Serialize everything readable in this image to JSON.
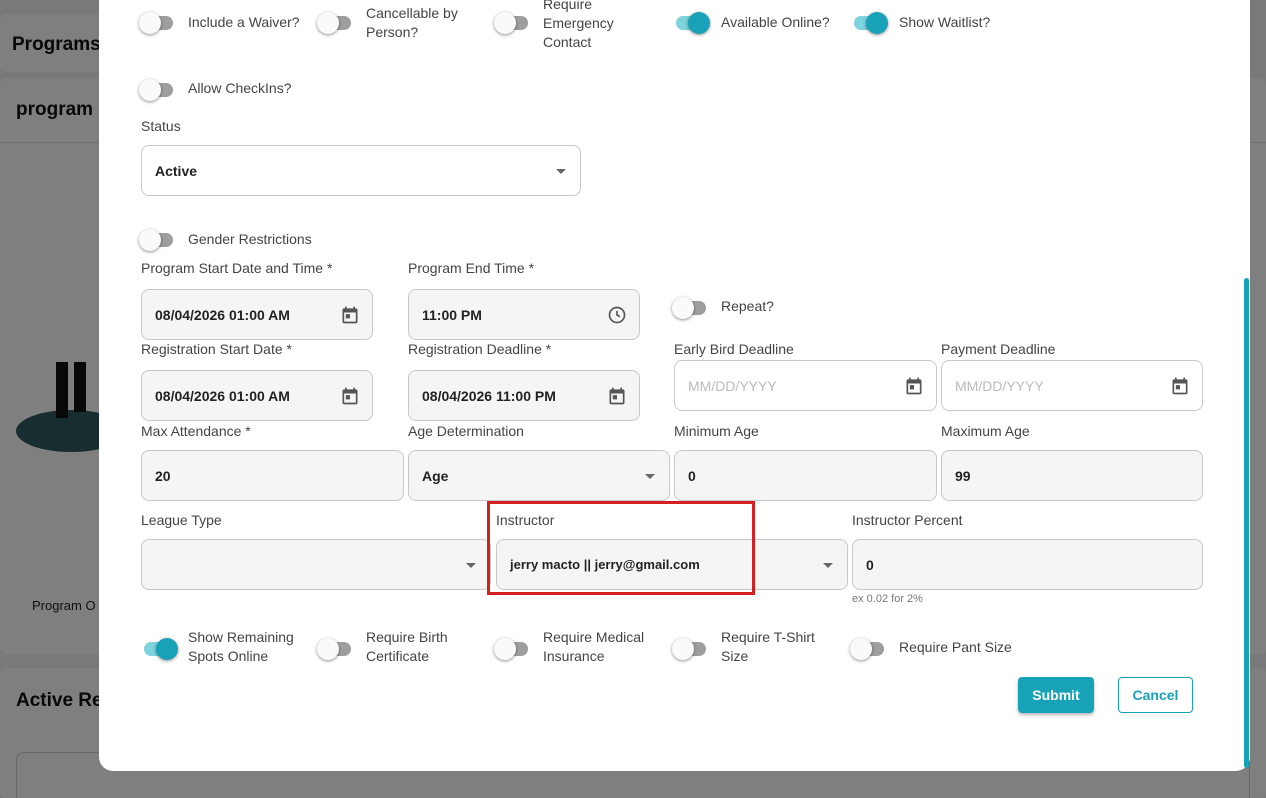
{
  "background": {
    "programs_heading": "Programs",
    "program_title": "program",
    "program_o_text": "Program O",
    "active_heading": "Active Re"
  },
  "toggles_top": [
    {
      "label": "Include a Waiver?",
      "on": false
    },
    {
      "label": "Cancellable by Person?",
      "on": false
    },
    {
      "label": "Require Emergency Contact",
      "on": false
    },
    {
      "label": "Available Online?",
      "on": true
    },
    {
      "label": "Show Waitlist?",
      "on": true
    }
  ],
  "allow_checkins": {
    "label": "Allow CheckIns?",
    "on": false
  },
  "status": {
    "label": "Status",
    "value": "Active"
  },
  "gender_restrictions": {
    "label": "Gender Restrictions",
    "on": false
  },
  "program_start": {
    "label": "Program Start Date and Time *",
    "value": "08/04/2026 01:00 AM",
    "icon": "calendar-icon"
  },
  "program_end": {
    "label": "Program End Time *",
    "value": "11:00 PM",
    "icon": "clock-icon"
  },
  "repeat": {
    "label": "Repeat?",
    "on": false
  },
  "registration_start": {
    "label": "Registration Start Date *",
    "value": "08/04/2026 01:00 AM"
  },
  "registration_deadline": {
    "label": "Registration Deadline *",
    "value": "08/04/2026 11:00 PM"
  },
  "early_bird": {
    "label": "Early Bird Deadline",
    "placeholder": "MM/DD/YYYY"
  },
  "payment_deadline": {
    "label": "Payment Deadline",
    "placeholder": "MM/DD/YYYY"
  },
  "max_attendance": {
    "label": "Max Attendance *",
    "value": "20"
  },
  "age_determination": {
    "label": "Age Determination",
    "value": "Age"
  },
  "minimum_age": {
    "label": "Minimum Age",
    "value": "0"
  },
  "maximum_age": {
    "label": "Maximum Age",
    "value": "99"
  },
  "league_type": {
    "label": "League Type",
    "value": ""
  },
  "instructor": {
    "label": "Instructor",
    "value": "jerry macto || jerry@gmail.com"
  },
  "instructor_percent": {
    "label": "Instructor Percent",
    "value": "0",
    "hint": "ex 0.02 for 2%"
  },
  "toggles_bottom": [
    {
      "label": "Show Remaining Spots Online",
      "on": true
    },
    {
      "label": "Require Birth Certificate",
      "on": false
    },
    {
      "label": "Require Medical Insurance",
      "on": false
    },
    {
      "label": "Require T-Shirt Size",
      "on": false
    },
    {
      "label": "Require Pant Size",
      "on": false
    }
  ],
  "buttons": {
    "submit": "Submit",
    "cancel": "Cancel"
  },
  "colors": {
    "accent": "#17a2b8",
    "highlight": "#d42020"
  }
}
